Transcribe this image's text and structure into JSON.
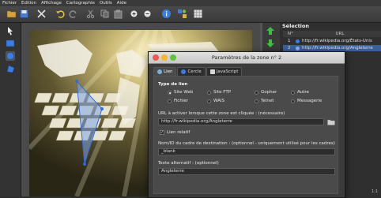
{
  "menu": [
    "Fichier",
    "Edition",
    "Affichage",
    "Cartographie",
    "Outils",
    "Aide"
  ],
  "selection_panel": {
    "title": "Sélection",
    "columns": [
      "N°",
      "URL"
    ],
    "rows": [
      {
        "num": "1",
        "url": "http://fr.wikipedia.org/États-Unis"
      },
      {
        "num": "2",
        "url": "http://fr.wikipedia.org/Angleterre"
      }
    ]
  },
  "dialog": {
    "title": "Paramètres de la zone n° 2",
    "tabs": [
      "Lien",
      "Cercle",
      "JavaScript"
    ],
    "link_type_label": "Type de lien",
    "link_types": [
      {
        "label": "Site Web",
        "selected": true
      },
      {
        "label": "Site FTP",
        "selected": false
      },
      {
        "label": "Gopher",
        "selected": false
      },
      {
        "label": "Autre",
        "selected": false
      },
      {
        "label": "Fichier",
        "selected": false
      },
      {
        "label": "WAIS",
        "selected": false
      },
      {
        "label": "Telnet",
        "selected": false
      },
      {
        "label": "Messagerie",
        "selected": false
      }
    ],
    "url_label": "URL à activer lorsque cette zone est cliquée : (nécessaire)",
    "url_value": "http://fr.wikipedia.org/Angleterre",
    "relative_link_label": "Lien relatif",
    "relative_link_checked": true,
    "frame_label": "Nom/ID du cadre de destination : (optionnel - uniquement utilisé pour les cadres)",
    "frame_value": "_blank",
    "alt_label": "Texte alternatif : (optionnel)",
    "alt_value": "Angleterre"
  },
  "status": "1:1"
}
